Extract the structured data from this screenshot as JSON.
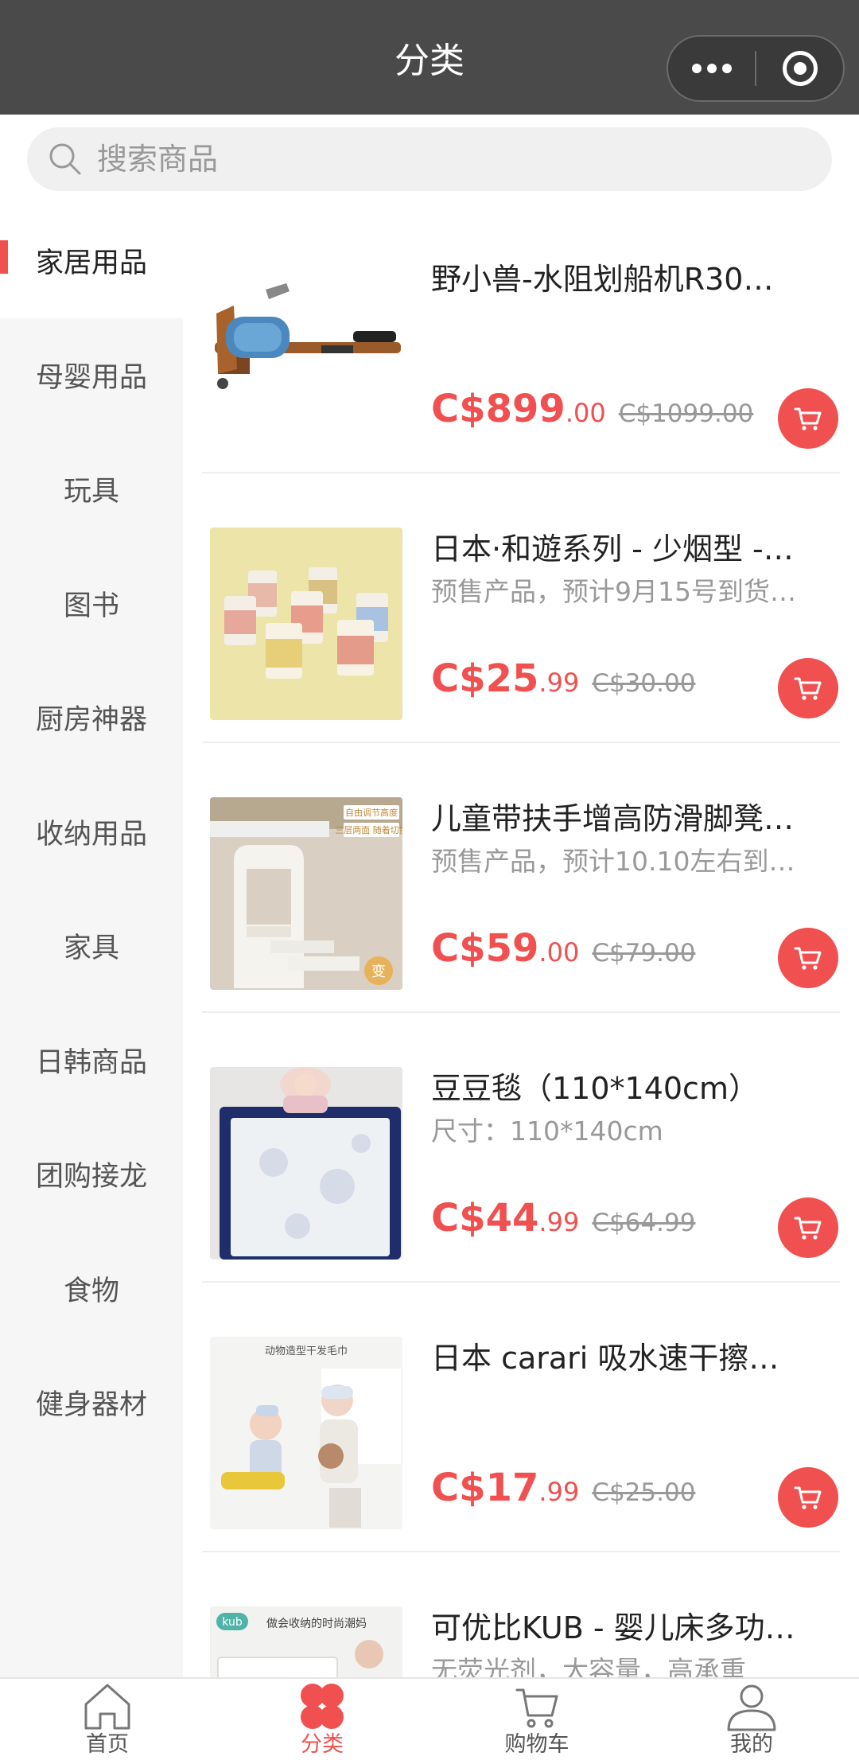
{
  "header": {
    "title": "分类"
  },
  "search": {
    "placeholder": "搜索商品"
  },
  "sidebar": {
    "items": [
      {
        "label": "家居用品",
        "active": true
      },
      {
        "label": "母婴用品"
      },
      {
        "label": "玩具"
      },
      {
        "label": "图书"
      },
      {
        "label": "厨房神器"
      },
      {
        "label": "收纳用品"
      },
      {
        "label": "家具"
      },
      {
        "label": "日韩商品"
      },
      {
        "label": "团购接龙"
      },
      {
        "label": "食物"
      },
      {
        "label": "健身器材"
      }
    ]
  },
  "products": [
    {
      "name": "野小兽-水阻划船机R30…",
      "desc": "",
      "price_main": "C$899",
      "price_dec": ".00",
      "orig_price": "C$1099.00"
    },
    {
      "name": "日本·和遊系列 - 少烟型 -…",
      "desc": "预售产品，预计9月15号到货…",
      "price_main": "C$25",
      "price_dec": ".99",
      "orig_price": "C$30.00"
    },
    {
      "name": "儿童带扶手增高防滑脚凳…",
      "desc": "预售产品，预计10.10左右到…",
      "price_main": "C$59",
      "price_dec": ".00",
      "orig_price": "C$79.00"
    },
    {
      "name": "豆豆毯（110*140cm）",
      "desc": "尺寸：110*140cm",
      "price_main": "C$44",
      "price_dec": ".99",
      "orig_price": "C$64.99"
    },
    {
      "name": "日本 carari 吸水速干擦…",
      "desc": "",
      "price_main": "C$17",
      "price_dec": ".99",
      "orig_price": "C$25.00"
    },
    {
      "name": "可优比KUB - 婴儿床多功…",
      "desc": "无荧光剂，大容量，高承重",
      "price_main": "",
      "price_dec": "",
      "orig_price": ""
    }
  ],
  "product_image_text": {
    "stool_tag1": "自由调节高度",
    "stool_tag2": "三层两面 随着切换",
    "stool_badge": "变",
    "towel_caption": "动物造型干发毛巾",
    "kub_logo": "kub",
    "kub_caption": "做会收纳的时尚潮妈"
  },
  "tabbar": {
    "items": [
      {
        "label": "首页",
        "icon": "home-icon"
      },
      {
        "label": "分类",
        "icon": "category-icon",
        "active": true
      },
      {
        "label": "购物车",
        "icon": "cart-icon"
      },
      {
        "label": "我的",
        "icon": "user-icon"
      }
    ]
  },
  "colors": {
    "accent": "#f0504f",
    "titlebar": "#4a4a4a",
    "sidebar_bg": "#f6f6f6"
  }
}
